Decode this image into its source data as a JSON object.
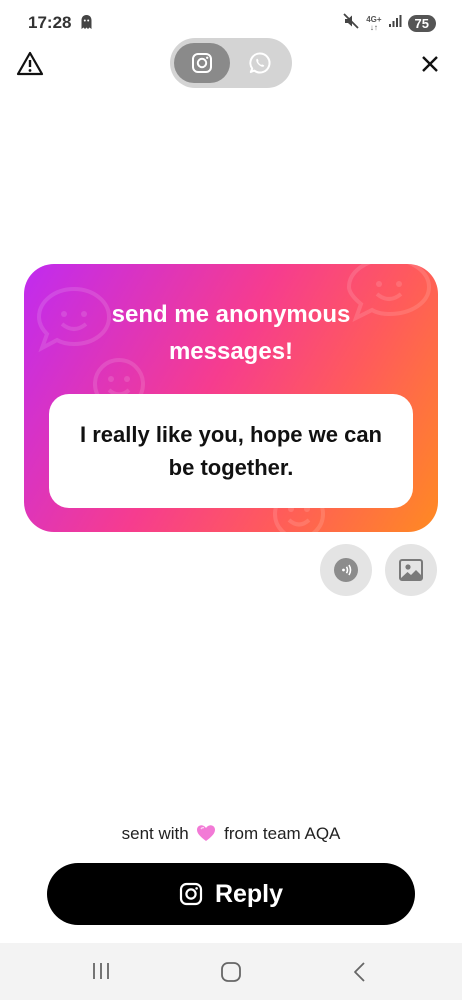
{
  "status_bar": {
    "time": "17:28",
    "network_label_top": "4G+",
    "network_label_bottom": "↓↑",
    "battery": "75"
  },
  "header": {
    "toggle": {
      "selected": "instagram",
      "options": [
        "instagram",
        "whatsapp"
      ]
    }
  },
  "card": {
    "title_line1": "send me anonymous",
    "title_line2": "messages!",
    "message": "I really like you, hope we can be together.",
    "colors": {
      "gradient_start": "#c02bf0",
      "gradient_mid": "#f63c8f",
      "gradient_end": "#ff8a22"
    }
  },
  "actions": {
    "audio_icon": "audio-wave-icon",
    "image_icon": "image-icon"
  },
  "footer": {
    "credit_prefix": "sent with",
    "credit_suffix": "from team AQA"
  },
  "reply_button": {
    "label": "Reply",
    "icon": "instagram-icon"
  },
  "nav": {
    "items": [
      "recent-apps",
      "home",
      "back"
    ]
  }
}
